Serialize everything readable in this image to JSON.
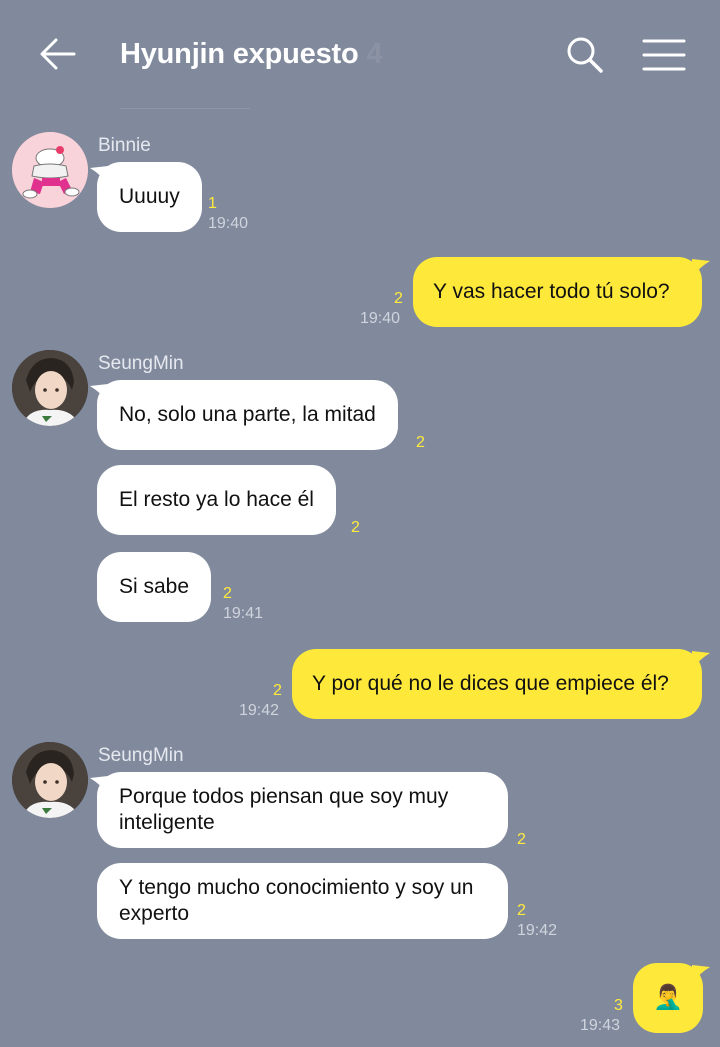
{
  "header": {
    "title": "Hyunjin expuesto",
    "member_count": "4"
  },
  "messages": [
    {
      "sender": "Binnie",
      "text": "Uuuuy",
      "unread": "1",
      "time": "19:40"
    },
    {
      "text": "Y vas hacer todo tú solo?",
      "unread": "2",
      "time": "19:40"
    },
    {
      "sender": "SeungMin",
      "text": "No, solo una parte, la mitad",
      "unread": "2"
    },
    {
      "text": "El resto ya lo hace él",
      "unread": "2"
    },
    {
      "text": "Si sabe",
      "unread": "2",
      "time": "19:41"
    },
    {
      "text": "Y por qué no le dices que empiece él?",
      "unread": "2",
      "time": "19:42"
    },
    {
      "sender": "SeungMin",
      "line1": "Porque todos piensan que soy muy",
      "line2": "inteligente",
      "unread": "2"
    },
    {
      "line1": "Y tengo mucho conocimiento y soy un",
      "line2": "experto",
      "unread": "2",
      "time": "19:42"
    },
    {
      "text": "🤦‍♂️",
      "unread": "3",
      "time": "19:43"
    }
  ],
  "colors": {
    "background": "#818a9c",
    "outgoing_bubble": "#fee93a",
    "incoming_bubble": "#ffffff",
    "unread_count": "#ffeb3b"
  }
}
